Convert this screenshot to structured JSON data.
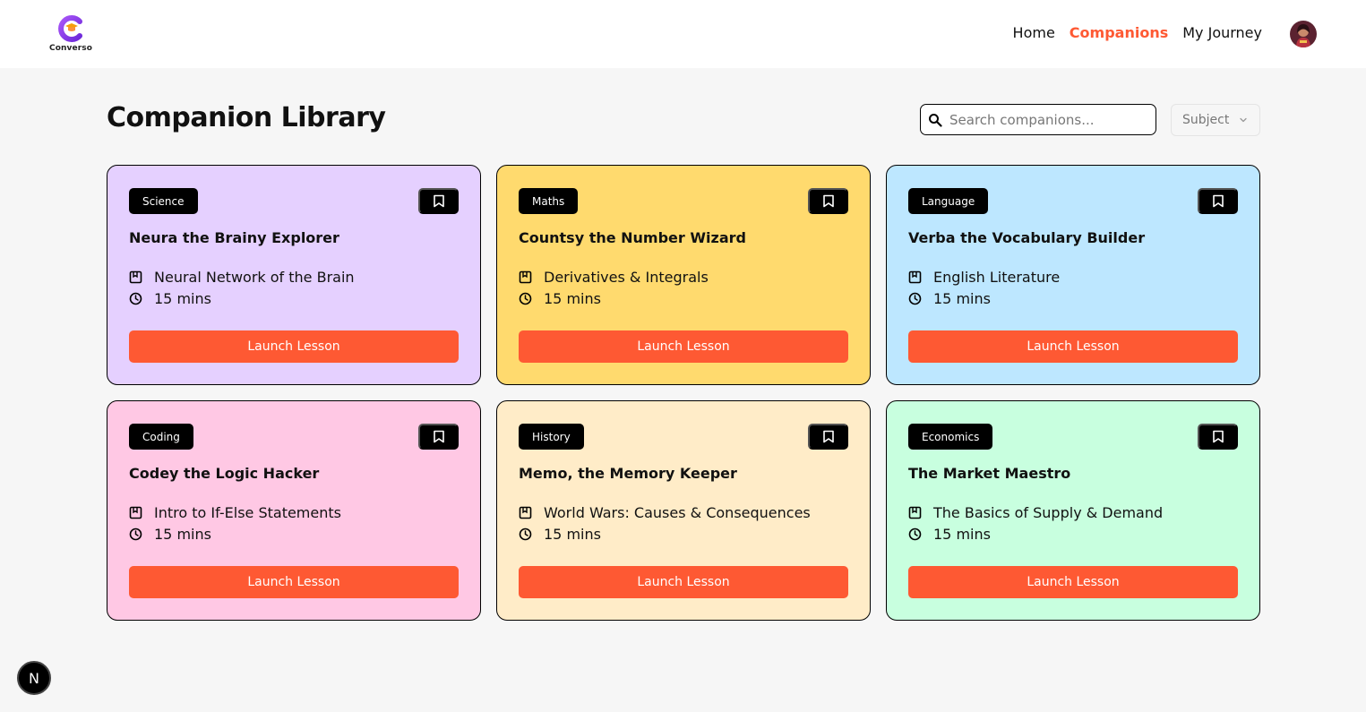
{
  "brand": {
    "name": "Converso"
  },
  "nav": {
    "home": "Home",
    "companions": "Companions",
    "journey": "My Journey"
  },
  "page": {
    "title": "Companion Library"
  },
  "search": {
    "placeholder": "Search companions..."
  },
  "filter": {
    "label": "Subject"
  },
  "colors": {
    "accent": "#fe5933"
  },
  "cards": [
    {
      "subject": "Science",
      "name": "Neura the Brainy Explorer",
      "topic": "Neural Network of the Brain",
      "duration": "15 mins",
      "cta": "Launch Lesson",
      "color": "#e5d0ff"
    },
    {
      "subject": "Maths",
      "name": "Countsy the Number Wizard",
      "topic": "Derivatives & Integrals",
      "duration": "15 mins",
      "cta": "Launch Lesson",
      "color": "#ffda6e"
    },
    {
      "subject": "Language",
      "name": "Verba the Vocabulary Builder",
      "topic": "English Literature",
      "duration": "15 mins",
      "cta": "Launch Lesson",
      "color": "#bde7ff"
    },
    {
      "subject": "Coding",
      "name": "Codey the Logic Hacker",
      "topic": "Intro to If-Else Statements",
      "duration": "15 mins",
      "cta": "Launch Lesson",
      "color": "#ffc8e4"
    },
    {
      "subject": "History",
      "name": "Memo, the Memory Keeper",
      "topic": "World Wars: Causes & Consequences",
      "duration": "15 mins",
      "cta": "Launch Lesson",
      "color": "#ffecc8"
    },
    {
      "subject": "Economics",
      "name": "The Market Maestro",
      "topic": "The Basics of Supply & Demand",
      "duration": "15 mins",
      "cta": "Launch Lesson",
      "color": "#c8ffdf"
    }
  ],
  "dev_badge": {
    "letter": "N"
  }
}
